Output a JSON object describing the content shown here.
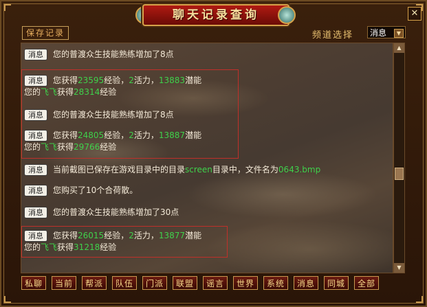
{
  "window": {
    "title": "聊天记录查询",
    "close_glyph": "✕"
  },
  "toolbar": {
    "save_label": "保存记录",
    "channel_label": "频道选择",
    "channel_value": "消息"
  },
  "messages": [
    {
      "badge": "消息",
      "line1": [
        {
          "t": "您的普渡众生技能熟练增加了8点"
        }
      ]
    },
    {
      "badge": "消息",
      "line1": [
        {
          "t": "您获得"
        },
        {
          "t": "23595",
          "g": true
        },
        {
          "t": "经验，"
        },
        {
          "t": "2",
          "g": true
        },
        {
          "t": "活力，"
        },
        {
          "t": "13883",
          "g": true
        },
        {
          "t": "潜能"
        }
      ],
      "line2": [
        {
          "t": "您的"
        },
        {
          "t": "飞飞",
          "g": true
        },
        {
          "t": "获得"
        },
        {
          "t": "28314",
          "g": true
        },
        {
          "t": "经验"
        }
      ]
    },
    {
      "badge": "消息",
      "line1": [
        {
          "t": "您的普渡众生技能熟练增加了8点"
        }
      ]
    },
    {
      "badge": "消息",
      "line1": [
        {
          "t": "您获得"
        },
        {
          "t": "24805",
          "g": true
        },
        {
          "t": "经验，"
        },
        {
          "t": "2",
          "g": true
        },
        {
          "t": "活力，"
        },
        {
          "t": "13887",
          "g": true
        },
        {
          "t": "潜能"
        }
      ],
      "line2": [
        {
          "t": "您的"
        },
        {
          "t": "飞飞",
          "g": true
        },
        {
          "t": "获得"
        },
        {
          "t": "29766",
          "g": true
        },
        {
          "t": "经验"
        }
      ]
    },
    {
      "badge": "消息",
      "line1": [
        {
          "t": "当前截图已保存在游戏目录中的目录"
        },
        {
          "t": "screen",
          "g": true
        },
        {
          "t": "目录中，文件名为"
        },
        {
          "t": "0643.bmp",
          "g": true
        }
      ]
    },
    {
      "badge": "消息",
      "line1": [
        {
          "t": "您购买了10个合荷散。"
        }
      ]
    },
    {
      "badge": "消息",
      "line1": [
        {
          "t": "您的普渡众生技能熟练增加了30点"
        }
      ]
    },
    {
      "badge": "消息",
      "line1": [
        {
          "t": "您获得"
        },
        {
          "t": "26015",
          "g": true
        },
        {
          "t": "经验，"
        },
        {
          "t": "2",
          "g": true
        },
        {
          "t": "活力，"
        },
        {
          "t": "13877",
          "g": true
        },
        {
          "t": "潜能"
        }
      ],
      "line2": [
        {
          "t": "您的"
        },
        {
          "t": "飞飞",
          "g": true
        },
        {
          "t": "获得"
        },
        {
          "t": "31218",
          "g": true
        },
        {
          "t": "经验"
        }
      ]
    }
  ],
  "tabs": [
    "私聊",
    "当前",
    "帮派",
    "队伍",
    "门派",
    "联盟",
    "谣言",
    "世界",
    "系统",
    "消息",
    "同城",
    "全部"
  ],
  "colors": {
    "highlight": "#3fd14b",
    "box": "#c0302a"
  },
  "scroll_position": 0.58
}
